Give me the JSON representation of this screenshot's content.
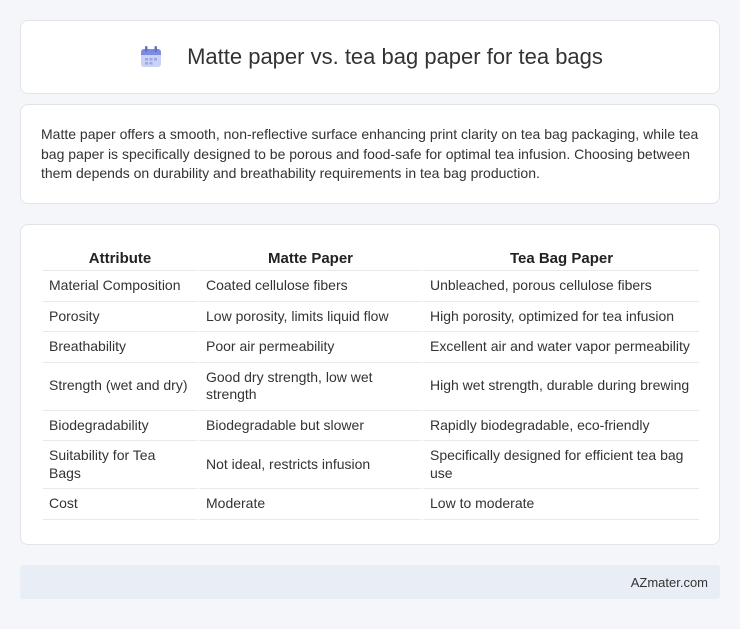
{
  "header": {
    "title": "Matte paper vs. tea bag paper for tea bags",
    "icon": "calendar-icon"
  },
  "description": "Matte paper offers a smooth, non-reflective surface enhancing print clarity on tea bag packaging, while tea bag paper is specifically designed to be porous and food-safe for optimal tea infusion. Choosing between them depends on durability and breathability requirements in tea bag production.",
  "table": {
    "headers": [
      "Attribute",
      "Matte Paper",
      "Tea Bag Paper"
    ],
    "rows": [
      [
        "Material Composition",
        "Coated cellulose fibers",
        "Unbleached, porous cellulose fibers"
      ],
      [
        "Porosity",
        "Low porosity, limits liquid flow",
        "High porosity, optimized for tea infusion"
      ],
      [
        "Breathability",
        "Poor air permeability",
        "Excellent air and water vapor permeability"
      ],
      [
        "Strength (wet and dry)",
        "Good dry strength, low wet strength",
        "High wet strength, durable during brewing"
      ],
      [
        "Biodegradability",
        "Biodegradable but slower",
        "Rapidly biodegradable, eco-friendly"
      ],
      [
        "Suitability for Tea Bags",
        "Not ideal, restricts infusion",
        "Specifically designed for efficient tea bag use"
      ],
      [
        "Cost",
        "Moderate",
        "Low to moderate"
      ]
    ]
  },
  "footer": {
    "brand": "AZmater.com"
  },
  "colors": {
    "background": "#f4f6f9",
    "card": "#ffffff",
    "footer_bg": "#e9eef6",
    "icon_accent": "#7b8ce0"
  }
}
